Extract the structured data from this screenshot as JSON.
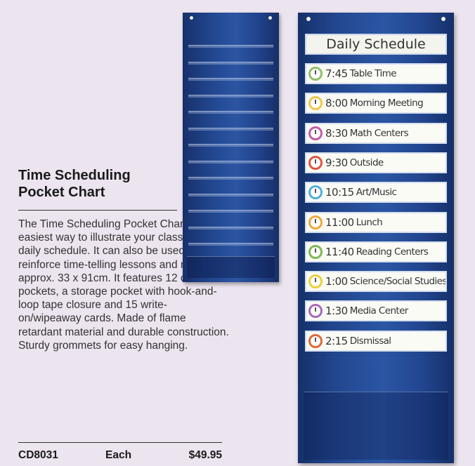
{
  "product": {
    "title": "Time Scheduling Pocket Chart",
    "description": "The Time Scheduling Pocket Chart is the easiest way to illustrate your classroom’s daily schedule. It can also be used to reinforce time-telling lessons and measures approx. 33 x 91cm. It features 12 clear pockets, a storage pocket with hook-and-loop tape closure and 15 write-on/wipeaway cards. Made of flame retardant material and durable construction. Sturdy grommets for easy hanging.",
    "code": "CD8031",
    "unit": "Each",
    "price": "$49.95"
  },
  "schedule": {
    "header": "Daily Schedule",
    "items": [
      {
        "time": "7:45",
        "activity": "Table Time",
        "color": "#8fbf6a"
      },
      {
        "time": "8:00",
        "activity": "Morning Meeting",
        "color": "#f2c64a"
      },
      {
        "time": "8:30",
        "activity": "Math Centers",
        "color": "#c45aa8"
      },
      {
        "time": "9:30",
        "activity": "Outside",
        "color": "#e2553f"
      },
      {
        "time": "10:15",
        "activity": "Art/Music",
        "color": "#4fb0d9"
      },
      {
        "time": "11:00",
        "activity": "Lunch",
        "color": "#f0a83c"
      },
      {
        "time": "11:40",
        "activity": "Reading Centers",
        "color": "#7db957"
      },
      {
        "time": "1:00",
        "activity": "Science/Social Studies",
        "color": "#e8d23c"
      },
      {
        "time": "1:30",
        "activity": "Media Center",
        "color": "#a66bb8"
      },
      {
        "time": "2:15",
        "activity": "Dismissal",
        "color": "#e06a3a"
      }
    ]
  }
}
